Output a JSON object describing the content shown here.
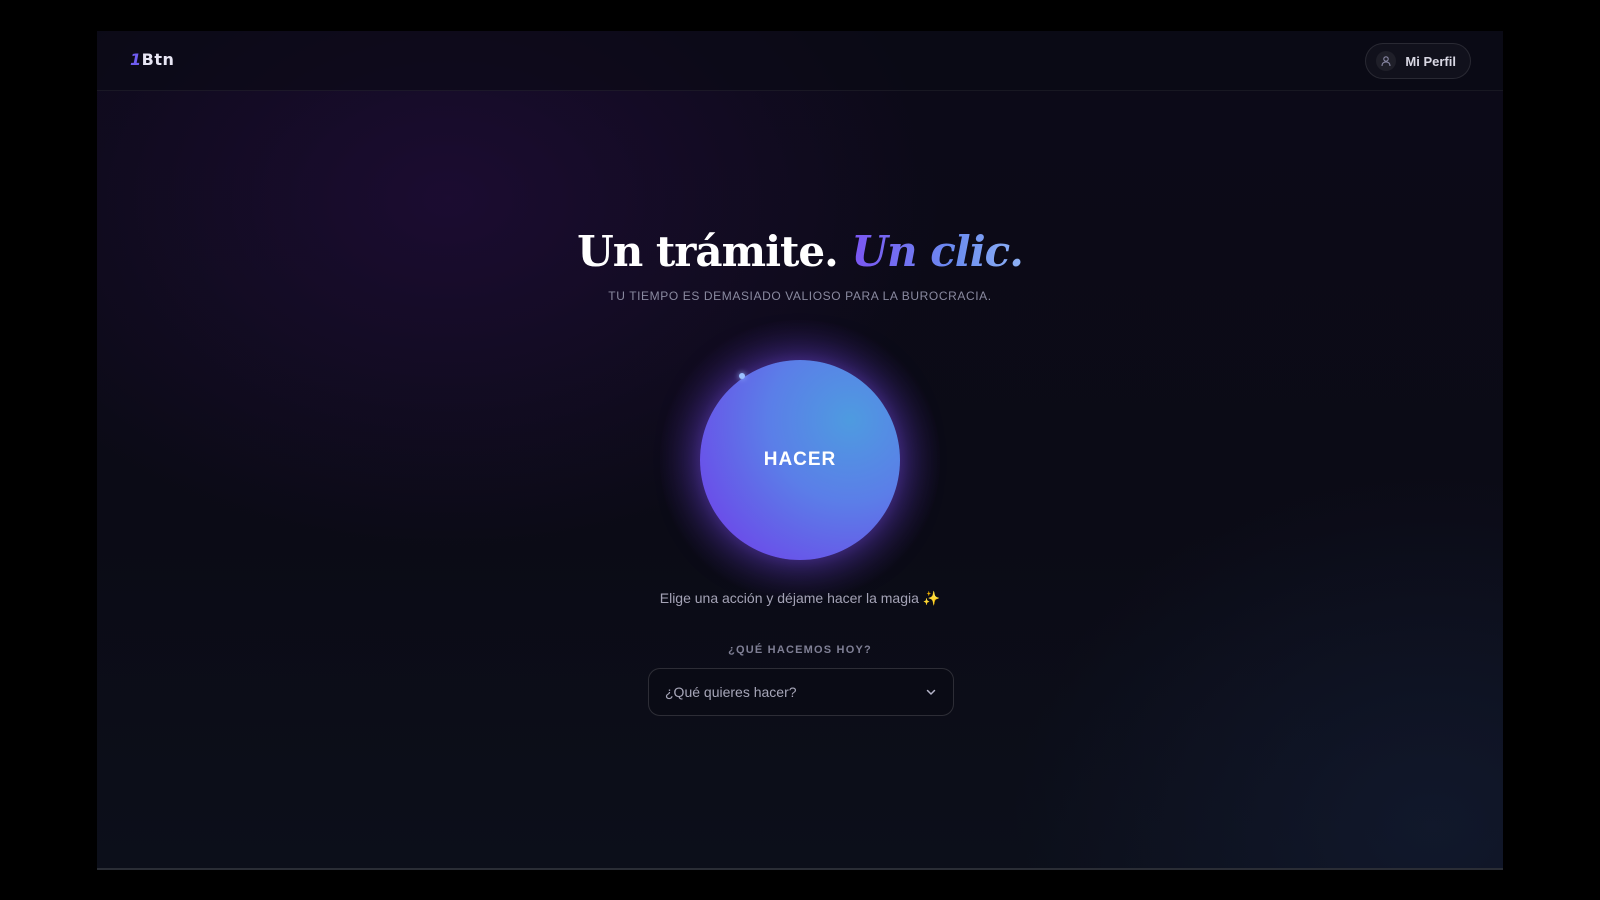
{
  "app": {
    "logo_mark": "1",
    "logo_text": "Btn"
  },
  "header": {
    "profile_label": "Mi Perfil",
    "profile_icon": "user-icon"
  },
  "hero": {
    "title_main": "Un trámite.",
    "title_accent": "Un clic.",
    "subtitle": "TU TIEMPO ES DEMASIADO VALIOSO PARA LA BUROCRACIA."
  },
  "action": {
    "button_label": "HACER",
    "hint": "Elige una acción y déjame hacer la magia",
    "hint_icon": "✨"
  },
  "selector": {
    "label": "¿QUÉ HACEMOS HOY?",
    "placeholder": "¿Qué quieres hacer?",
    "icon": "chevron-down-icon"
  },
  "colors": {
    "accent_purple": "#6f5cf0",
    "accent_blue": "#4f94dd",
    "background": "#0b0b16"
  }
}
